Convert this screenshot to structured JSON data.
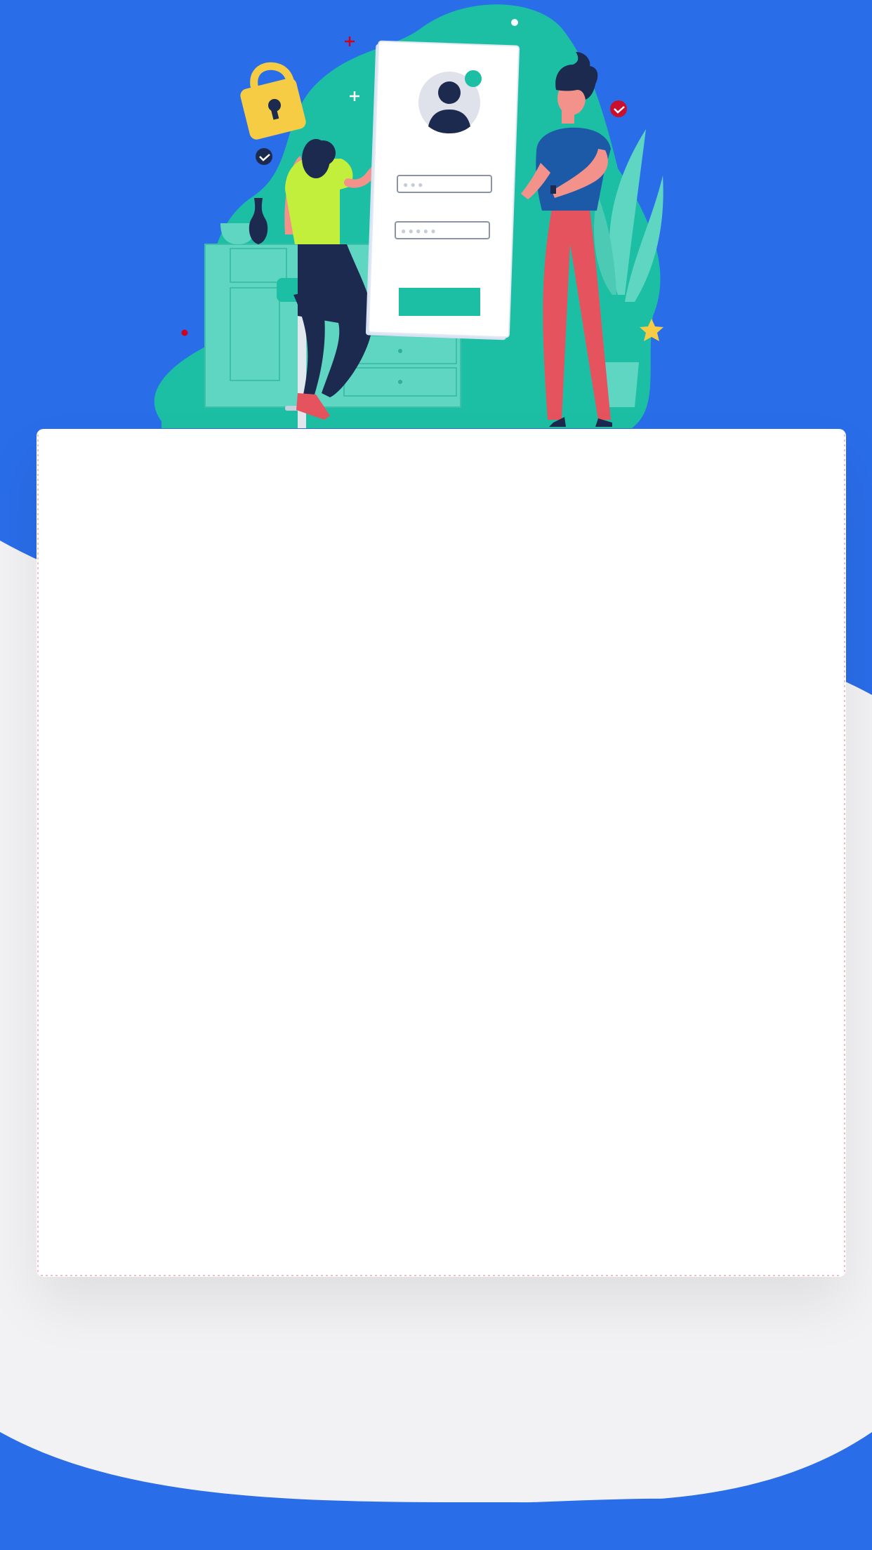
{
  "colors": {
    "brand_blue": "#2a6de9",
    "teal": "#1dbfa4",
    "teal_light": "#5fd6c2",
    "lock_yellow": "#f7cc45",
    "navy": "#1d2a4f",
    "lime": "#c2ef3c",
    "coral": "#e5535f",
    "shirt_blue": "#1c5aa8",
    "card_white": "#ffffff",
    "page_grey": "#f1f1f3"
  },
  "illustration": {
    "phone": {
      "username_dots": "● ● ●",
      "password_dots": "● ● ● ● ●"
    }
  },
  "icons": [
    "padlock-icon",
    "user-avatar-icon",
    "checkmark-badge-icon",
    "star-icon",
    "plus-sparkle-icon"
  ]
}
